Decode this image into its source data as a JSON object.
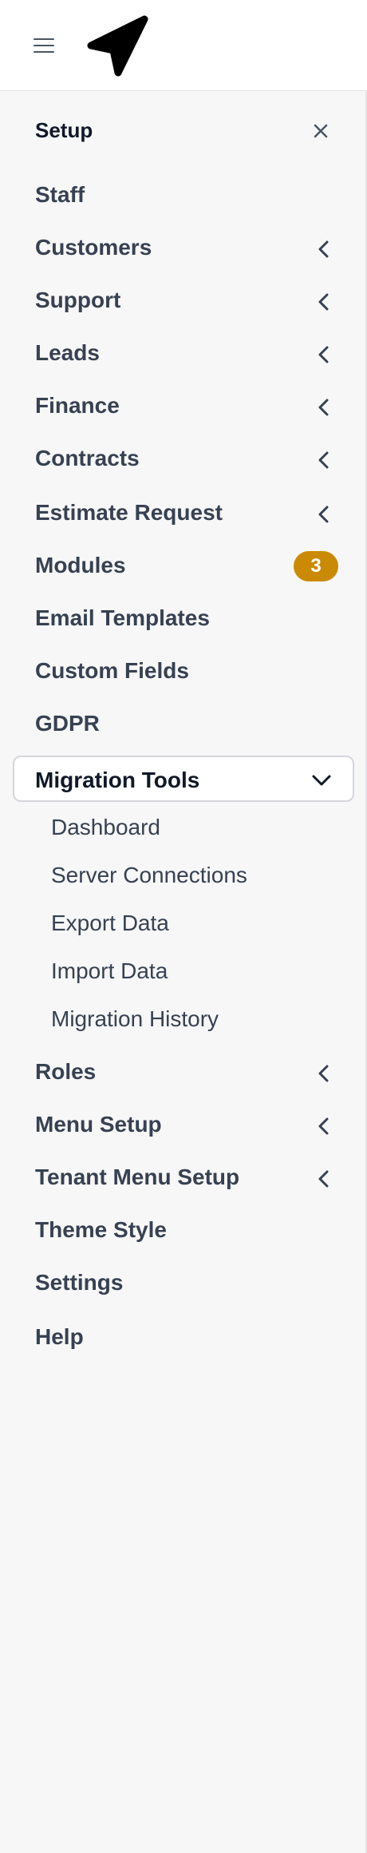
{
  "sidebar": {
    "header": "Setup",
    "items": [
      {
        "label": "Staff"
      },
      {
        "label": "Customers"
      },
      {
        "label": "Support"
      },
      {
        "label": "Leads"
      },
      {
        "label": "Finance"
      },
      {
        "label": "Contracts"
      },
      {
        "label": "Estimate Request"
      },
      {
        "label": "Modules",
        "badge": "3"
      },
      {
        "label": "Email Templates"
      },
      {
        "label": "Custom Fields"
      },
      {
        "label": "GDPR"
      },
      {
        "label": "Migration Tools"
      },
      {
        "label": "Roles"
      },
      {
        "label": "Menu Setup"
      },
      {
        "label": "Tenant Menu Setup"
      },
      {
        "label": "Theme Style"
      },
      {
        "label": "Settings"
      },
      {
        "label": "Help"
      }
    ],
    "migration_submenu": [
      {
        "label": "Dashboard"
      },
      {
        "label": "Server Connections"
      },
      {
        "label": "Export Data"
      },
      {
        "label": "Import Data"
      },
      {
        "label": "Migration History"
      }
    ]
  },
  "icons": {
    "menu": "hamburger-menu-icon",
    "logo": "navigation-arrow-logo",
    "close": "close-icon",
    "collapsed": "chevron-left-icon",
    "expanded": "chevron-down-icon"
  },
  "colors": {
    "sidebar_bg": "#f7f7f8",
    "text": "#374151",
    "badge": "#ca8a04"
  }
}
